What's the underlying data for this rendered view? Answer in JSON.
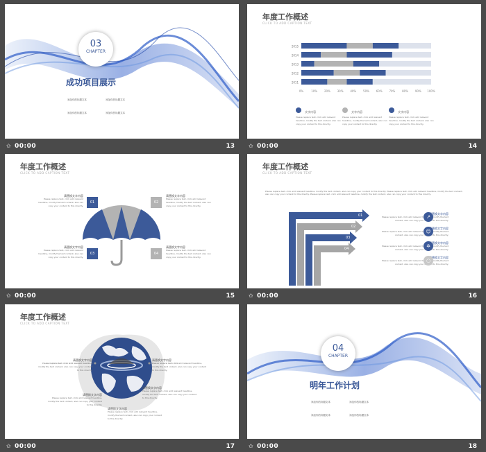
{
  "slides": [
    {
      "num": "13",
      "time": "00:00",
      "badge_num": "03",
      "badge_label": "CHAPTER",
      "title": "成功项目展示",
      "bullets": [
        "添加你的标题文本",
        "添加你的标题文本",
        "添加你的标题文本",
        "添加你的标题文本"
      ]
    },
    {
      "num": "14",
      "time": "00:00",
      "title": "年度工作概述",
      "subtitle": "CLICK TO ADD CAPTION TEXT",
      "legend": [
        "文字内容",
        "文字内容",
        "文字内容"
      ],
      "legend_desc": "Please replace text, click add relevant headline, modify the text content, also can copy your content to this directly."
    },
    {
      "num": "15",
      "time": "00:00",
      "title": "年度工作概述",
      "subtitle": "CLICK TO ADD CAPTION TEXT",
      "labels": [
        "请替换文字内容",
        "请替换文字内容",
        "请替换文字内容",
        "请替换文字内容"
      ],
      "boxes": [
        "01",
        "02",
        "03",
        "04"
      ],
      "desc": "Please replace text, click add relevant headline, modify the text content, also can copy your content to this directly."
    },
    {
      "num": "16",
      "time": "00:00",
      "title": "年度工作概述",
      "subtitle": "CLICK TO ADD CAPTION TEXT",
      "intro": "Please replace text, click add relevant headline, modify the text content, also can copy your content to this directly. Please replace text, click add relevant headline, modify the text content, also can copy your content to this directly. Please replace text, click add relevant headline, modify the text content, also can copy your content to this directly.",
      "arrows": [
        "01",
        "02",
        "03",
        "04"
      ],
      "items": [
        "请替换文字内容",
        "请替换文字内容",
        "请替换文字内容",
        "请替换文字内容"
      ],
      "desc": "Please replace text, click add relevant headline, modify the text content, also can copy your content to this directly."
    },
    {
      "num": "17",
      "time": "00:00",
      "title": "年度工作概述",
      "subtitle": "CLICK TO ADD CAPTION TEXT",
      "labels": [
        "请替换文字内容",
        "请替换文字内容",
        "请替换文字内容",
        "请替换文字内容"
      ],
      "desc": "Please replace text, click add relevant headline, modify the text content, also can copy your content to this directly."
    },
    {
      "num": "18",
      "time": "00:00",
      "badge_num": "04",
      "badge_label": "CHAPTER",
      "title": "明年工作计划",
      "bullets": [
        "添加你的标题文本",
        "添加你的标题文本",
        "添加你的标题文本",
        "添加你的标题文本"
      ]
    }
  ],
  "chart_data": {
    "type": "bar",
    "orientation": "horizontal",
    "stacked": true,
    "categories": [
      "2015",
      "2014",
      "2013",
      "2012",
      "2011"
    ],
    "x_ticks": [
      "0%",
      "10%",
      "20%",
      "30%",
      "40%",
      "50%",
      "60%",
      "70%",
      "80%",
      "90%",
      "100%"
    ],
    "series": [
      {
        "name": "文字内容",
        "color": "#3c5a99",
        "values": [
          35,
          15,
          10,
          25,
          20
        ]
      },
      {
        "name": "文字内容",
        "color": "#b3b3b3",
        "values": [
          20,
          20,
          30,
          20,
          15
        ]
      },
      {
        "name": "文字内容",
        "color": "#3c5a99",
        "values": [
          20,
          35,
          20,
          20,
          20
        ]
      },
      {
        "name": "",
        "color": "#dde2ec",
        "values": [
          25,
          30,
          40,
          35,
          45
        ]
      }
    ],
    "xlim": [
      0,
      100
    ]
  },
  "colors": {
    "accent": "#3c5a99",
    "gray": "#b3b3b3",
    "bg": "#4a4a4a"
  }
}
